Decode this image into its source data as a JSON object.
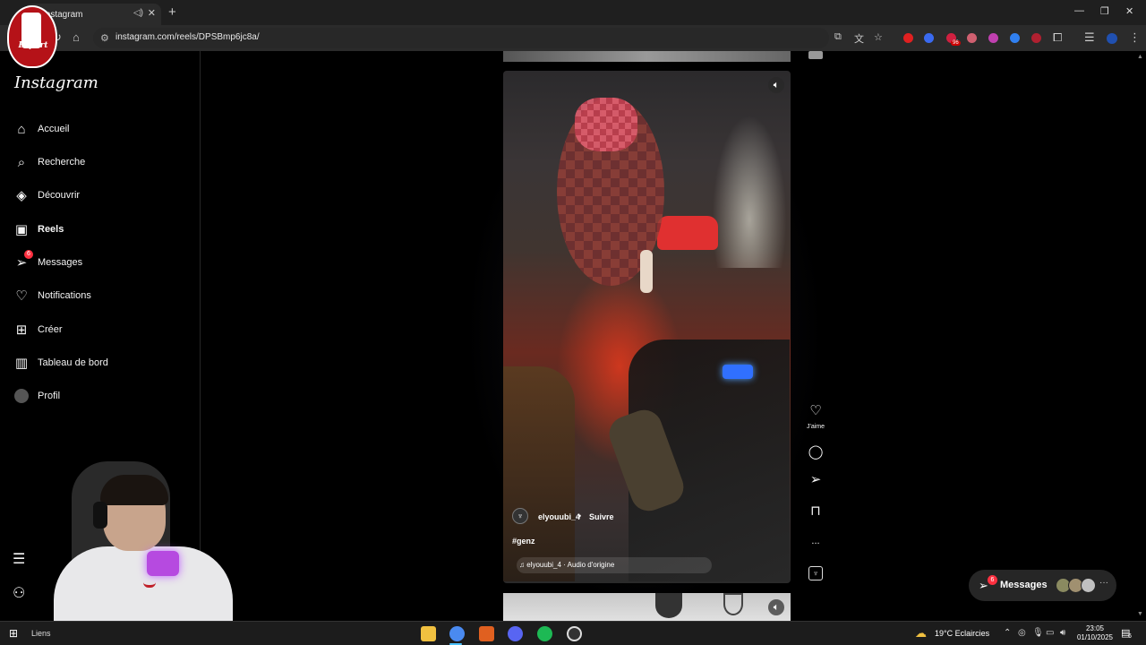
{
  "browser": {
    "tab_title": "Instagram",
    "url": "instagram.com/reels/DPSBmp6jc8a/",
    "extension_badge": "96"
  },
  "sidebar": {
    "logo": "Instagram",
    "items": [
      {
        "label": "Accueil",
        "icon": "home-icon"
      },
      {
        "label": "Recherche",
        "icon": "search-icon"
      },
      {
        "label": "Découvrir",
        "icon": "compass-icon"
      },
      {
        "label": "Reels",
        "icon": "reels-icon"
      },
      {
        "label": "Messages",
        "icon": "messenger-icon",
        "badge": "6"
      },
      {
        "label": "Notifications",
        "icon": "heart-icon"
      },
      {
        "label": "Créer",
        "icon": "plus-square-icon"
      },
      {
        "label": "Tableau de bord",
        "icon": "chart-icon"
      },
      {
        "label": "Profil",
        "icon": "avatar"
      }
    ],
    "active": "Reels"
  },
  "overlay": {
    "esport_text": "Esport"
  },
  "reel": {
    "username": "elyouubi_4",
    "separator": "•",
    "follow_label": "Suivre",
    "caption": "#genz",
    "audio": "elyouubi_4 · Audio d'origine"
  },
  "actions": {
    "like_label": "J'aime",
    "more_label": "..."
  },
  "messages_float": {
    "label": "Messages",
    "badge": "6"
  },
  "taskbar": {
    "links_label": "Liens",
    "weather": "19°C  Eclaircies",
    "time": "23:05",
    "date": "01/10/2025",
    "notification_count": "6"
  },
  "colors": {
    "background": "#000000",
    "notification_badge": "#ff3040",
    "sidebar_border": "#262626"
  }
}
